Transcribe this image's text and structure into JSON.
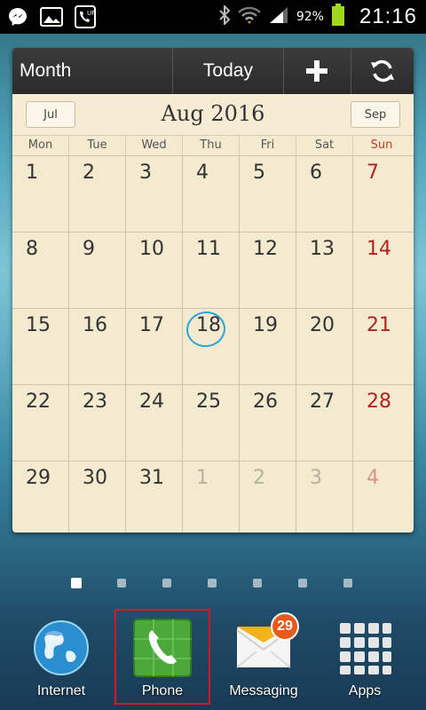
{
  "status_bar": {
    "icons": [
      "messenger-icon",
      "gallery-icon",
      "voicemail-icon"
    ],
    "battery_percent": "92%",
    "time": "21:16"
  },
  "calendar_widget": {
    "toolbar": {
      "view_label": "Month",
      "today_label": "Today",
      "add_icon": "plus-icon",
      "refresh_icon": "refresh-icon"
    },
    "prev_month": "Jul",
    "next_month": "Sep",
    "month_title": "Aug 2016",
    "weekdays": [
      "Mon",
      "Tue",
      "Wed",
      "Thu",
      "Fri",
      "Sat",
      "Sun"
    ],
    "weeks": [
      [
        "1",
        "2",
        "3",
        "4",
        "5",
        "6",
        "7"
      ],
      [
        "8",
        "9",
        "10",
        "11",
        "12",
        "13",
        "14"
      ],
      [
        "15",
        "16",
        "17",
        "18",
        "19",
        "20",
        "21"
      ],
      [
        "22",
        "23",
        "24",
        "25",
        "26",
        "27",
        "28"
      ],
      [
        "29",
        "30",
        "31",
        "1",
        "2",
        "3",
        "4"
      ]
    ],
    "today": "18"
  },
  "home_pages": {
    "count": 7,
    "active_index": 0
  },
  "dock": {
    "apps": [
      {
        "label": "Internet",
        "icon": "globe-icon"
      },
      {
        "label": "Phone",
        "icon": "phone-icon"
      },
      {
        "label": "Messaging",
        "icon": "envelope-icon",
        "badge": "29"
      },
      {
        "label": "Apps",
        "icon": "grid-icon"
      }
    ]
  },
  "colors": {
    "sunday": "#b0231d",
    "today_circle": "#2aa3d8",
    "badge": "#e8591c",
    "highlight": "#e0141e"
  }
}
